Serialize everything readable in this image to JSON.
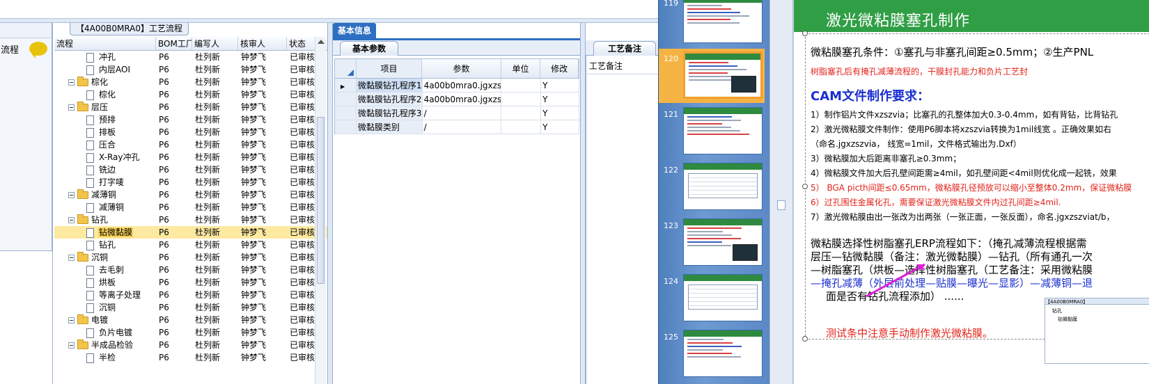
{
  "left_panel": {
    "label": "流程"
  },
  "tree": {
    "title": "【4A00B0MRA0】工艺流程",
    "columns": [
      "流程",
      "BOM工厂",
      "编写人",
      "核审人",
      "状态"
    ],
    "rows": [
      {
        "type": "leaf",
        "name": "冲孔",
        "bom": "P6",
        "writer": "杜列新",
        "reviewer": "钟梦飞",
        "status": "已审核"
      },
      {
        "type": "leaf",
        "name": "内层AOI",
        "bom": "P6",
        "writer": "杜列新",
        "reviewer": "钟梦飞",
        "status": "已审核"
      },
      {
        "type": "folder",
        "name": "棕化",
        "bom": "P6",
        "writer": "杜列新",
        "reviewer": "钟梦飞",
        "status": "已审核"
      },
      {
        "type": "leaf",
        "name": "棕化",
        "bom": "P6",
        "writer": "杜列新",
        "reviewer": "钟梦飞",
        "status": "已审核"
      },
      {
        "type": "folder",
        "name": "层压",
        "bom": "P6",
        "writer": "杜列新",
        "reviewer": "钟梦飞",
        "status": "已审核"
      },
      {
        "type": "leaf",
        "name": "预排",
        "bom": "P6",
        "writer": "杜列新",
        "reviewer": "钟梦飞",
        "status": "已审核"
      },
      {
        "type": "leaf",
        "name": "排板",
        "bom": "P6",
        "writer": "杜列新",
        "reviewer": "钟梦飞",
        "status": "已审核"
      },
      {
        "type": "leaf",
        "name": "压合",
        "bom": "P6",
        "writer": "杜列新",
        "reviewer": "钟梦飞",
        "status": "已审核"
      },
      {
        "type": "leaf",
        "name": "X-Ray冲孔",
        "bom": "P6",
        "writer": "杜列新",
        "reviewer": "钟梦飞",
        "status": "已审核"
      },
      {
        "type": "leaf",
        "name": "铣边",
        "bom": "P6",
        "writer": "杜列新",
        "reviewer": "钟梦飞",
        "status": "已审核"
      },
      {
        "type": "leaf",
        "name": "打字唛",
        "bom": "P6",
        "writer": "杜列新",
        "reviewer": "钟梦飞",
        "status": "已审核"
      },
      {
        "type": "folder",
        "name": "减薄铜",
        "bom": "P6",
        "writer": "杜列新",
        "reviewer": "钟梦飞",
        "status": "已审核"
      },
      {
        "type": "leaf",
        "name": "减薄铜",
        "bom": "P6",
        "writer": "杜列新",
        "reviewer": "钟梦飞",
        "status": "已审核"
      },
      {
        "type": "folder",
        "name": "钻孔",
        "bom": "P6",
        "writer": "杜列新",
        "reviewer": "钟梦飞",
        "status": "已审核"
      },
      {
        "type": "leaf",
        "name": "钻微黏膜",
        "bom": "P6",
        "writer": "杜列新",
        "reviewer": "钟梦飞",
        "status": "已审核",
        "selected": true
      },
      {
        "type": "leaf",
        "name": "钻孔",
        "bom": "P6",
        "writer": "杜列新",
        "reviewer": "钟梦飞",
        "status": "已审核"
      },
      {
        "type": "folder",
        "name": "沉铜",
        "bom": "P6",
        "writer": "杜列新",
        "reviewer": "钟梦飞",
        "status": "已审核"
      },
      {
        "type": "leaf",
        "name": "去毛刺",
        "bom": "P6",
        "writer": "杜列新",
        "reviewer": "钟梦飞",
        "status": "已审核"
      },
      {
        "type": "leaf",
        "name": "烘板",
        "bom": "P6",
        "writer": "杜列新",
        "reviewer": "钟梦飞",
        "status": "已审核"
      },
      {
        "type": "leaf",
        "name": "等离子处理",
        "bom": "P6",
        "writer": "杜列新",
        "reviewer": "钟梦飞",
        "status": "已审核"
      },
      {
        "type": "leaf",
        "name": "沉铜",
        "bom": "P6",
        "writer": "杜列新",
        "reviewer": "钟梦飞",
        "status": "已审核"
      },
      {
        "type": "folder",
        "name": "电镀",
        "bom": "P6",
        "writer": "杜列新",
        "reviewer": "钟梦飞",
        "status": "已审核"
      },
      {
        "type": "leaf",
        "name": "负片电镀",
        "bom": "P6",
        "writer": "杜列新",
        "reviewer": "钟梦飞",
        "status": "已审核"
      },
      {
        "type": "folder",
        "name": "半成品检验",
        "bom": "P6",
        "writer": "杜列新",
        "reviewer": "钟梦飞",
        "status": "已审核"
      },
      {
        "type": "leaf",
        "name": "半检",
        "bom": "P6",
        "writer": "杜列新",
        "reviewer": "钟梦飞",
        "status": "已审核"
      }
    ]
  },
  "basic_info": {
    "tab_label": "基本信息",
    "subtab_label": "基本参数",
    "columns": [
      "项目",
      "参数",
      "单位",
      "修改"
    ],
    "rows": [
      {
        "item": "微黏膜钻孔程序1",
        "param": "4a00b0mra0.jgxzs...",
        "unit": "",
        "edit": "Y"
      },
      {
        "item": "微黏膜钻孔程序2",
        "param": "4a00b0mra0.jgxzs...",
        "unit": "",
        "edit": "Y"
      },
      {
        "item": "微黏膜钻孔程序3",
        "param": "/",
        "unit": "",
        "edit": "Y"
      },
      {
        "item": "微黏膜类别",
        "param": "/",
        "unit": "",
        "edit": "Y"
      }
    ]
  },
  "process_notes": {
    "tab_label": "工艺备注",
    "label": "工艺备注"
  },
  "slides": {
    "numbers": [
      "119",
      "120",
      "121",
      "122",
      "123",
      "124",
      "125"
    ],
    "selected": "120"
  },
  "slide": {
    "title": "激光微粘膜塞孔制作",
    "line1": "微粘膜塞孔条件：①塞孔与非塞孔间距≥0.5mm；②生产PNL",
    "line2": "树脂塞孔后有掩孔减薄流程的，干膜封孔能力和负片工艺封",
    "cam_title": "CAM文件制作要求：",
    "req1": "1）制作铝片文件xzszvia；比塞孔的孔整体加大0.3-0.4mm，如有背钻，比背钻孔",
    "req2": "2）激光微粘膜文件制作：使用P6脚本将xzszvia转换为1mil线宽 。正确效果如右",
    "req2b": "（命名.jgxzszvia， 线宽=1mil，文件格式输出为.Dxf）",
    "req3": "3）微粘膜加大后距离非塞孔≥0.3mm；",
    "req4": "4）微粘膜文件加大后孔壁间距需≥4mil，如孔壁间距<4mil则优化成一起铣，效果",
    "req5": "5） BGA picth间距≤0.65mm，微粘膜孔径预放可以缩小至整体0.2mm，保证微粘膜",
    "req6": "6）过孔围住金属化孔，需要保证激光微粘膜文件内过孔间距≥4mil.",
    "req7": "7）激光微粘膜由出一张改为出两张（一张正面，一张反面），命名.jgxzszviat/b，",
    "erp1": "微粘膜选择性树脂塞孔ERP流程如下：（掩孔减薄流程根据需",
    "erp2": "层压—钻微黏膜（备注：激光微黏膜）—钻孔（所有通孔一次",
    "erp3": "—树脂塞孔（烘板—选择性树脂塞孔（工艺备注：采用微粘膜",
    "erp4": "—掩孔减薄（外层前处理—贴膜—曝光—显影）—减薄铜—退",
    "erp5": "面是否有钻孔流程添加） ......",
    "footer": "测试条中注意手动制作激光微粘膜。",
    "mini_shot_text": "【4A00B0MRA0】",
    "mini_shot_row1": "钻孔",
    "mini_shot_row2": "钻微黏膜"
  }
}
